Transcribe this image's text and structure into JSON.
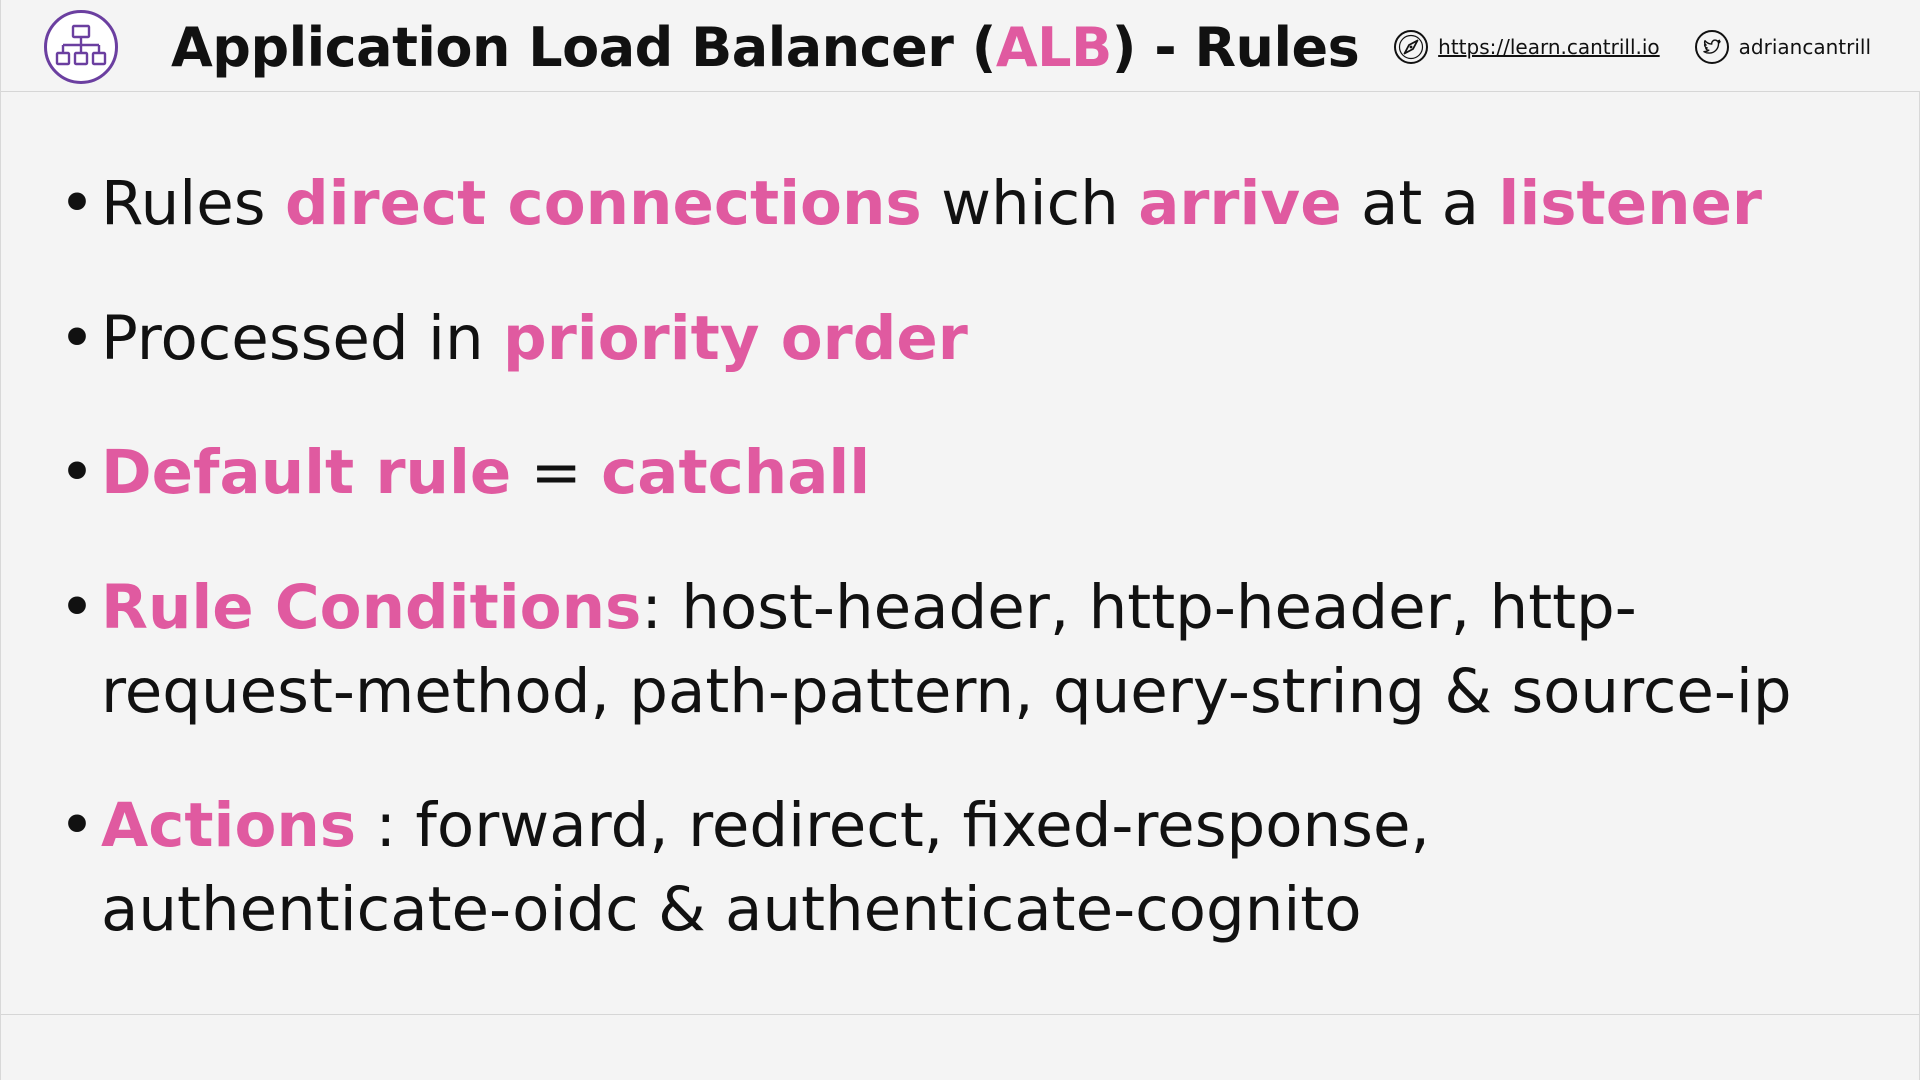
{
  "header": {
    "title_prefix": "Application Load Balancer (",
    "title_accent": "ALB",
    "title_suffix": ") - Rules",
    "website": "https://learn.cantrill.io",
    "twitter": "adriancantrill"
  },
  "icons": {
    "service": "load-balancer-icon",
    "website": "compass-icon",
    "twitter": "twitter-bird-icon"
  },
  "colors": {
    "accent": "#e05aa0",
    "icon_purple": "#6b3fa0",
    "text": "#111111",
    "background": "#f4f4f4"
  },
  "bullets": [
    {
      "segments": [
        {
          "text": "Rules ",
          "hl": false
        },
        {
          "text": "direct connections",
          "hl": true
        },
        {
          "text": " which ",
          "hl": false
        },
        {
          "text": "arrive",
          "hl": true
        },
        {
          "text": " at a ",
          "hl": false
        },
        {
          "text": "listener",
          "hl": true
        }
      ]
    },
    {
      "segments": [
        {
          "text": "Processed in ",
          "hl": false
        },
        {
          "text": "priority order",
          "hl": true
        }
      ]
    },
    {
      "segments": [
        {
          "text": "Default rule",
          "hl": true
        },
        {
          "text": " = ",
          "hl": false
        },
        {
          "text": "catchall",
          "hl": true
        }
      ]
    },
    {
      "segments": [
        {
          "text": "Rule Conditions",
          "hl": true
        },
        {
          "text": ": host-header, http-header, http-request-method, path-pattern, query-string & source-ip",
          "hl": false
        }
      ]
    },
    {
      "segments": [
        {
          "text": "Actions",
          "hl": true
        },
        {
          "text": " : forward, redirect, fixed-response, authenticate-oidc & authenticate-cognito",
          "hl": false
        }
      ]
    }
  ]
}
